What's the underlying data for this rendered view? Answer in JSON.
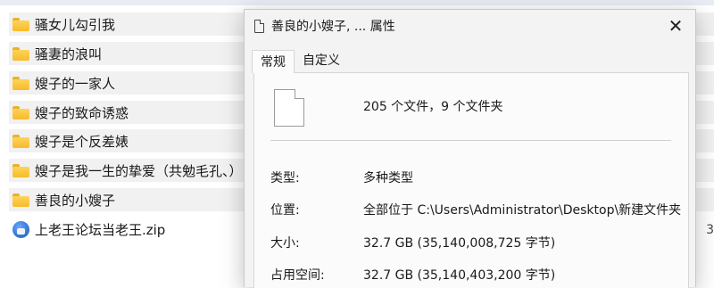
{
  "explorer": {
    "items": [
      {
        "name": "骚女儿勾引我",
        "type": "folder"
      },
      {
        "name": "骚妻的浪叫",
        "type": "folder"
      },
      {
        "name": "嫂子的一家人",
        "type": "folder"
      },
      {
        "name": "嫂子的致命诱惑",
        "type": "folder"
      },
      {
        "name": "嫂子是个反差婊",
        "type": "folder"
      },
      {
        "name": "嫂子是我一生的挚爱（共勉毛孔、）",
        "type": "folder"
      },
      {
        "name": "善良的小嫂子",
        "type": "folder"
      },
      {
        "name": "上老王论坛当老王.zip",
        "type": "zip"
      }
    ],
    "edge_digit": "3"
  },
  "dialog": {
    "title": "善良的小嫂子, ... 属性",
    "close_symbol": "✕",
    "tabs": [
      "常规",
      "自定义"
    ],
    "active_tab": "常规",
    "summary": "205 个文件，9 个文件夹",
    "properties": [
      {
        "label": "类型:",
        "value": "多种类型"
      },
      {
        "label": "位置:",
        "value": "全部位于 C:\\Users\\Administrator\\Desktop\\新建文件夹"
      },
      {
        "label": "大小:",
        "value": "32.7 GB (35,140,008,725 字节)"
      },
      {
        "label": "占用空间:",
        "value": "32.7 GB (35,140,403,200 字节)"
      }
    ],
    "icons": {
      "title": "document-icon",
      "summary": "documents-icon",
      "close": "close-icon",
      "folder": "folder-icon",
      "zip": "zip-archive-icon"
    }
  }
}
